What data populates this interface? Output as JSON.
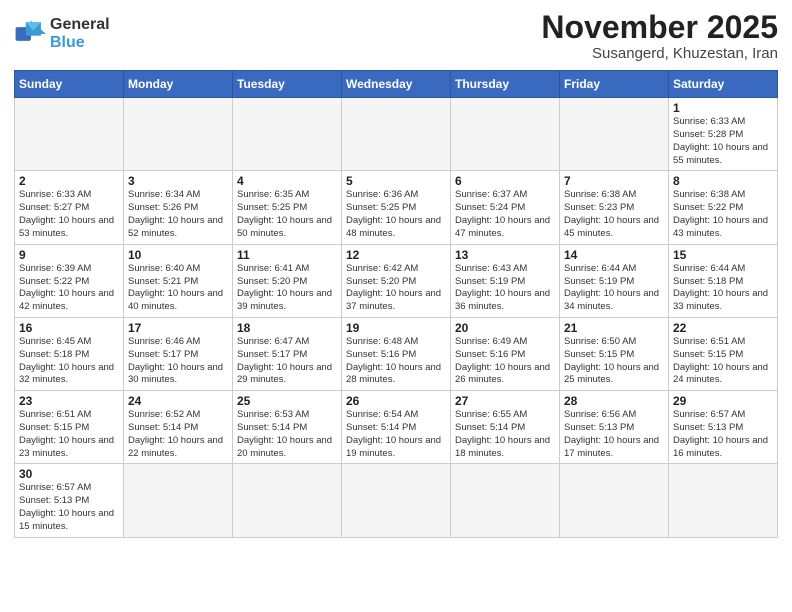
{
  "header": {
    "logo_general": "General",
    "logo_blue": "Blue",
    "month_year": "November 2025",
    "location": "Susangerd, Khuzestan, Iran"
  },
  "weekdays": [
    "Sunday",
    "Monday",
    "Tuesday",
    "Wednesday",
    "Thursday",
    "Friday",
    "Saturday"
  ],
  "days": [
    {
      "num": "",
      "info": "",
      "empty": true
    },
    {
      "num": "",
      "info": "",
      "empty": true
    },
    {
      "num": "",
      "info": "",
      "empty": true
    },
    {
      "num": "",
      "info": "",
      "empty": true
    },
    {
      "num": "",
      "info": "",
      "empty": true
    },
    {
      "num": "",
      "info": "",
      "empty": true
    },
    {
      "num": "1",
      "sunrise": "6:33 AM",
      "sunset": "5:28 PM",
      "daylight": "10 hours and 55 minutes."
    },
    {
      "num": "2",
      "sunrise": "6:33 AM",
      "sunset": "5:27 PM",
      "daylight": "10 hours and 53 minutes."
    },
    {
      "num": "3",
      "sunrise": "6:34 AM",
      "sunset": "5:26 PM",
      "daylight": "10 hours and 52 minutes."
    },
    {
      "num": "4",
      "sunrise": "6:35 AM",
      "sunset": "5:25 PM",
      "daylight": "10 hours and 50 minutes."
    },
    {
      "num": "5",
      "sunrise": "6:36 AM",
      "sunset": "5:25 PM",
      "daylight": "10 hours and 48 minutes."
    },
    {
      "num": "6",
      "sunrise": "6:37 AM",
      "sunset": "5:24 PM",
      "daylight": "10 hours and 47 minutes."
    },
    {
      "num": "7",
      "sunrise": "6:38 AM",
      "sunset": "5:23 PM",
      "daylight": "10 hours and 45 minutes."
    },
    {
      "num": "8",
      "sunrise": "6:38 AM",
      "sunset": "5:22 PM",
      "daylight": "10 hours and 43 minutes."
    },
    {
      "num": "9",
      "sunrise": "6:39 AM",
      "sunset": "5:22 PM",
      "daylight": "10 hours and 42 minutes."
    },
    {
      "num": "10",
      "sunrise": "6:40 AM",
      "sunset": "5:21 PM",
      "daylight": "10 hours and 40 minutes."
    },
    {
      "num": "11",
      "sunrise": "6:41 AM",
      "sunset": "5:20 PM",
      "daylight": "10 hours and 39 minutes."
    },
    {
      "num": "12",
      "sunrise": "6:42 AM",
      "sunset": "5:20 PM",
      "daylight": "10 hours and 37 minutes."
    },
    {
      "num": "13",
      "sunrise": "6:43 AM",
      "sunset": "5:19 PM",
      "daylight": "10 hours and 36 minutes."
    },
    {
      "num": "14",
      "sunrise": "6:44 AM",
      "sunset": "5:19 PM",
      "daylight": "10 hours and 34 minutes."
    },
    {
      "num": "15",
      "sunrise": "6:44 AM",
      "sunset": "5:18 PM",
      "daylight": "10 hours and 33 minutes."
    },
    {
      "num": "16",
      "sunrise": "6:45 AM",
      "sunset": "5:18 PM",
      "daylight": "10 hours and 32 minutes."
    },
    {
      "num": "17",
      "sunrise": "6:46 AM",
      "sunset": "5:17 PM",
      "daylight": "10 hours and 30 minutes."
    },
    {
      "num": "18",
      "sunrise": "6:47 AM",
      "sunset": "5:17 PM",
      "daylight": "10 hours and 29 minutes."
    },
    {
      "num": "19",
      "sunrise": "6:48 AM",
      "sunset": "5:16 PM",
      "daylight": "10 hours and 28 minutes."
    },
    {
      "num": "20",
      "sunrise": "6:49 AM",
      "sunset": "5:16 PM",
      "daylight": "10 hours and 26 minutes."
    },
    {
      "num": "21",
      "sunrise": "6:50 AM",
      "sunset": "5:15 PM",
      "daylight": "10 hours and 25 minutes."
    },
    {
      "num": "22",
      "sunrise": "6:51 AM",
      "sunset": "5:15 PM",
      "daylight": "10 hours and 24 minutes."
    },
    {
      "num": "23",
      "sunrise": "6:51 AM",
      "sunset": "5:15 PM",
      "daylight": "10 hours and 23 minutes."
    },
    {
      "num": "24",
      "sunrise": "6:52 AM",
      "sunset": "5:14 PM",
      "daylight": "10 hours and 22 minutes."
    },
    {
      "num": "25",
      "sunrise": "6:53 AM",
      "sunset": "5:14 PM",
      "daylight": "10 hours and 20 minutes."
    },
    {
      "num": "26",
      "sunrise": "6:54 AM",
      "sunset": "5:14 PM",
      "daylight": "10 hours and 19 minutes."
    },
    {
      "num": "27",
      "sunrise": "6:55 AM",
      "sunset": "5:14 PM",
      "daylight": "10 hours and 18 minutes."
    },
    {
      "num": "28",
      "sunrise": "6:56 AM",
      "sunset": "5:13 PM",
      "daylight": "10 hours and 17 minutes."
    },
    {
      "num": "29",
      "sunrise": "6:57 AM",
      "sunset": "5:13 PM",
      "daylight": "10 hours and 16 minutes."
    },
    {
      "num": "30",
      "sunrise": "6:57 AM",
      "sunset": "5:13 PM",
      "daylight": "10 hours and 15 minutes."
    },
    {
      "num": "",
      "info": "",
      "empty": true
    },
    {
      "num": "",
      "info": "",
      "empty": true
    },
    {
      "num": "",
      "info": "",
      "empty": true
    },
    {
      "num": "",
      "info": "",
      "empty": true
    },
    {
      "num": "",
      "info": "",
      "empty": true
    },
    {
      "num": "",
      "info": "",
      "empty": true
    }
  ]
}
